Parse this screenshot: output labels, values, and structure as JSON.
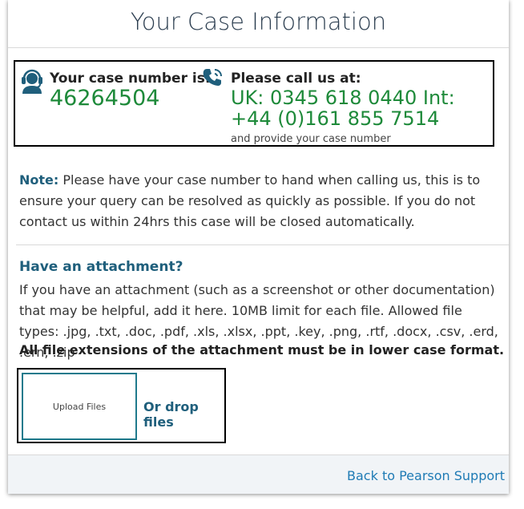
{
  "dialog": {
    "title": "Your Case Information"
  },
  "case": {
    "label": "Your case number is:",
    "number": "46264504"
  },
  "call": {
    "label": "Please call us at:",
    "numbers": "UK: 0345 618 0440 Int: +44 (0)161 855 7514",
    "note": "and provide your case number"
  },
  "note": {
    "label": "Note:",
    "text": " Please have your case number to hand when calling us, this is to ensure your query can be resolved as quickly as possible. If you do not contact us within 24hrs this case will be closed automatically."
  },
  "attachment": {
    "heading": "Have an attachment?",
    "description": "If you have an attachment (such as a screenshot or other documentation) that may be helpful, add it here. 10MB limit for each file. Allowed file types: .jpg, .txt, .doc, .pdf, .xls, .xlsx, .ppt, .key, .png, .rtf, .docx, .csv, .erd, .ern, .zip",
    "warning": "All file extensions of the attachment must be in lower case format.",
    "upload_label": "Upload Files",
    "drop_label": "Or drop files"
  },
  "footer": {
    "back_link": "Back to Pearson Support"
  },
  "icons": {
    "agent": "support-agent-icon",
    "phone": "phone-call-icon"
  },
  "colors": {
    "accent": "#1f5f7c",
    "highlight_number": "#1e8a3a",
    "link": "#1f7bb5"
  }
}
